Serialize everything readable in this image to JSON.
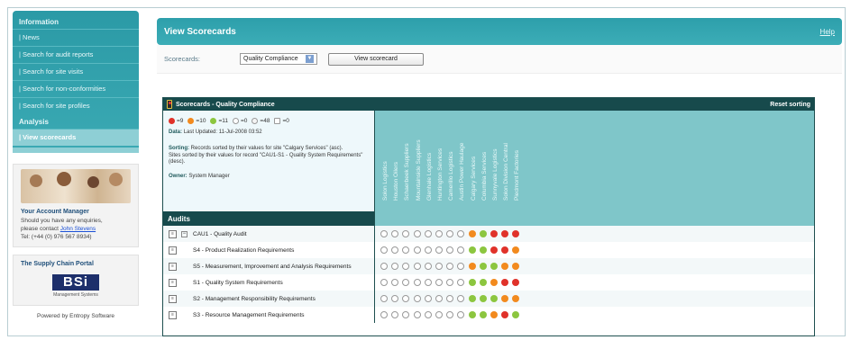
{
  "sidebar": {
    "sections": [
      {
        "title": "Information",
        "items": [
          "| News",
          "| Search for audit reports",
          "| Search for site visits",
          "| Search for non-conformities",
          "| Search for site profiles"
        ]
      },
      {
        "title": "Analysis",
        "items": [
          "| View scorecards"
        ]
      }
    ],
    "account": {
      "title": "Your Account Manager",
      "line1": "Should you have any enquiries,",
      "line2_prefix": "please contact ",
      "contact_name": "John Stevens",
      "phone": "Tel: (+44 (0) 976 567 8934)"
    },
    "portal": {
      "title": "The Supply Chain Portal",
      "logo_text": "BSi",
      "logo_sub": "Management Systems"
    },
    "powered_by": "Powered by Entropy Software"
  },
  "main": {
    "title": "View Scorecards",
    "help": "Help",
    "scorecards_label": "Scorecards:",
    "selected_scorecard": "Quality Compliance",
    "view_button": "View scorecard"
  },
  "scorecard": {
    "title": "Scorecards - Quality Compliance",
    "reset": "Reset sorting",
    "legend": [
      {
        "color": "#e0322a",
        "count": "9"
      },
      {
        "color": "#f28a1e",
        "count": "10"
      },
      {
        "color": "#8cc63f",
        "count": "11"
      },
      {
        "color": "#ffffff",
        "count": "0"
      },
      {
        "color": "#f4f4f4",
        "count": "48"
      },
      {
        "color": "#ffffff",
        "count": "0"
      }
    ],
    "data_label": "Data:",
    "data_value": "Last Updated: 11-Jul-2008 03:52",
    "sorting_label": "Sorting:",
    "sorting_line1": "Records sorted by their values for site \"Calgary Services\" (asc).",
    "sorting_line2": "Sites sorted by their values for record \"CAU1-S1 - Quality System Requirements\" (desc).",
    "owner_label": "Owner:",
    "owner_value": "System Manager",
    "audits_header": "Audits",
    "columns": [
      "Solon Logistics",
      "Houston Oilers",
      "Schaerbeek Suppliers",
      "Mountainside Suppliers",
      "Glenhale Logistics",
      "Huntington Services",
      "Camerillo Logistics",
      "Austin Power Haulage",
      "Calgary Services",
      "Columbia Services",
      "Sunnyvale Logistics",
      "Solon Division Central",
      "Piedmont Factories"
    ],
    "rows": [
      {
        "label": "CAU1 - Quality Audit",
        "parent": true,
        "dots": [
          "n",
          "n",
          "n",
          "n",
          "n",
          "n",
          "n",
          "n",
          "o",
          "g",
          "r",
          "r",
          "r"
        ]
      },
      {
        "label": "S4 - Product Realization Requirements",
        "parent": false,
        "dots": [
          "n",
          "n",
          "n",
          "n",
          "n",
          "n",
          "n",
          "n",
          "g",
          "g",
          "r",
          "r",
          "o"
        ]
      },
      {
        "label": "S5 - Measurement, Improvement and Analysis Requirements",
        "parent": false,
        "dots": [
          "n",
          "n",
          "n",
          "n",
          "n",
          "n",
          "n",
          "n",
          "o",
          "g",
          "g",
          "o",
          "o"
        ]
      },
      {
        "label": "S1 - Quality System Requirements",
        "parent": false,
        "dots": [
          "n",
          "n",
          "n",
          "n",
          "n",
          "n",
          "n",
          "n",
          "g",
          "g",
          "o",
          "r",
          "r"
        ]
      },
      {
        "label": "S2 - Management Responsibility Requirements",
        "parent": false,
        "dots": [
          "n",
          "n",
          "n",
          "n",
          "n",
          "n",
          "n",
          "n",
          "g",
          "g",
          "g",
          "o",
          "o"
        ]
      },
      {
        "label": "S3 - Resource Management Requirements",
        "parent": false,
        "dots": [
          "n",
          "n",
          "n",
          "n",
          "n",
          "n",
          "n",
          "n",
          "g",
          "g",
          "o",
          "r",
          "g"
        ]
      }
    ],
    "dot_colors": {
      "r": "#e0322a",
      "o": "#f28a1e",
      "g": "#8cc63f",
      "n": "#ffffff"
    }
  }
}
